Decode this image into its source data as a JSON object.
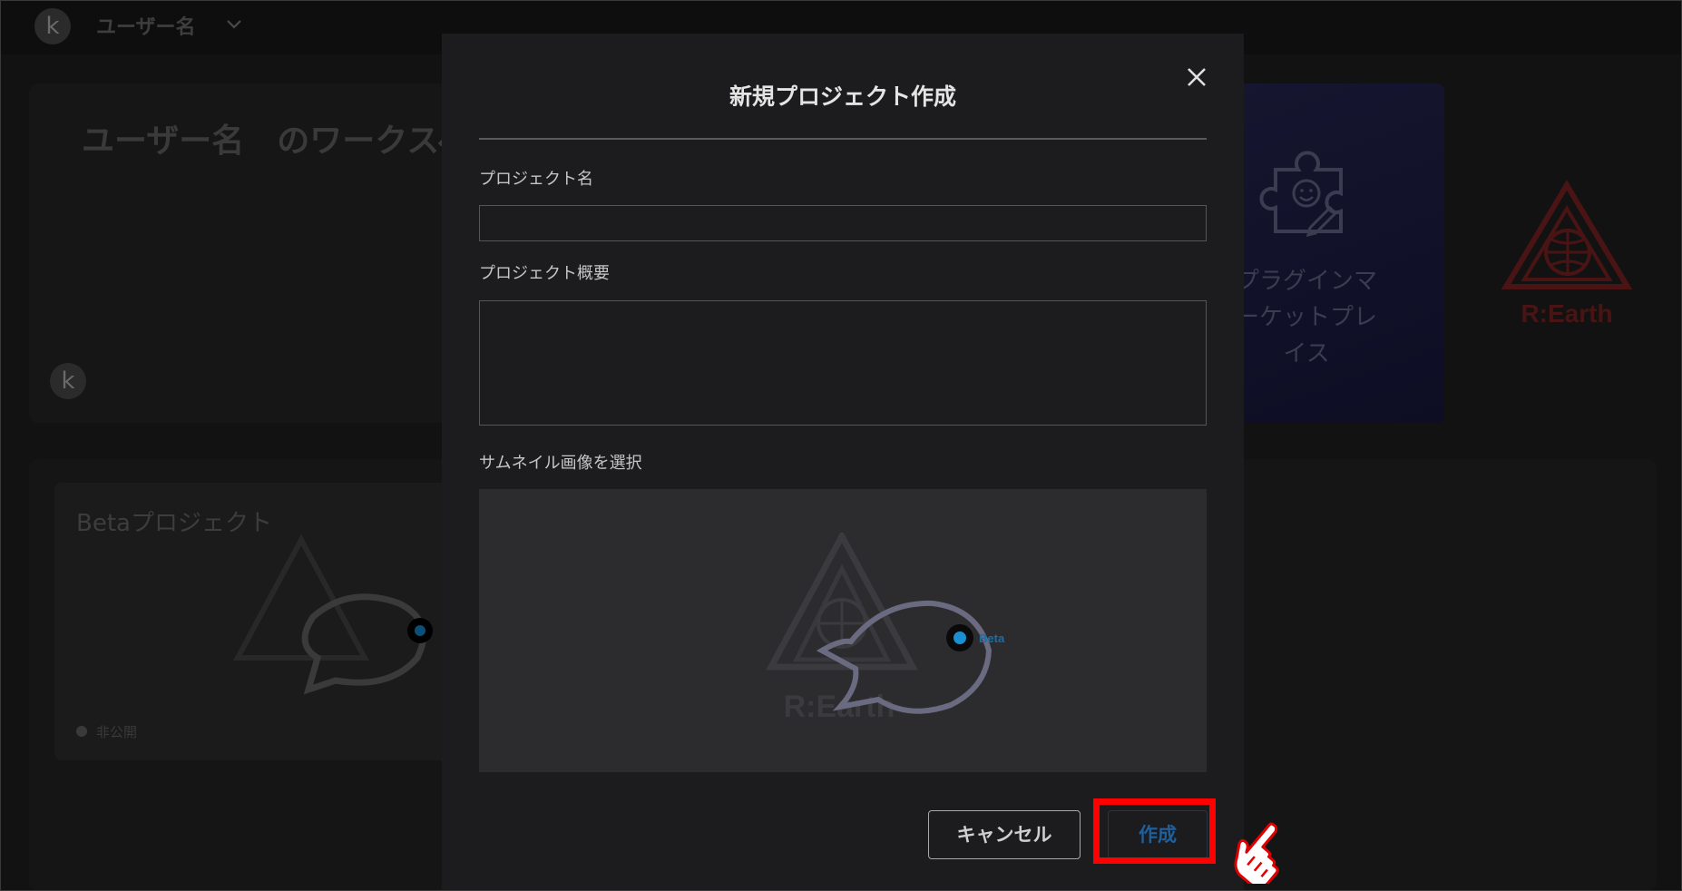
{
  "topbar": {
    "avatar_initial": "k",
    "username": "ユーザー名"
  },
  "workspace": {
    "title": "ユーザー名　のワークスペ",
    "avatar_initial": "k"
  },
  "plugin_tile": {
    "label_line1": "プラグインマ",
    "label_line2": "ーケットプレ",
    "label_line3": "イス"
  },
  "logo": {
    "text": "R:Earth"
  },
  "project_card": {
    "title": "Betaプロジェクト",
    "status": "非公開"
  },
  "modal": {
    "title": "新規プロジェクト作成",
    "name_label": "プロジェクト名",
    "name_value": "",
    "description_label": "プロジェクト概要",
    "description_value": "",
    "thumbnail_label": "サムネイル画像を選択",
    "thumbnail_logo_text": "R:Earth",
    "thumbnail_badge": "Beta",
    "cancel_label": "キャンセル",
    "create_label": "作成"
  },
  "colors": {
    "highlight": "#ff0000",
    "create_text": "#1f5f9a",
    "logo_red": "#4a1414"
  },
  "icons": [
    "close-icon",
    "chevron-down-icon",
    "puzzle-plugin-icon",
    "pointing-hand-icon"
  ]
}
